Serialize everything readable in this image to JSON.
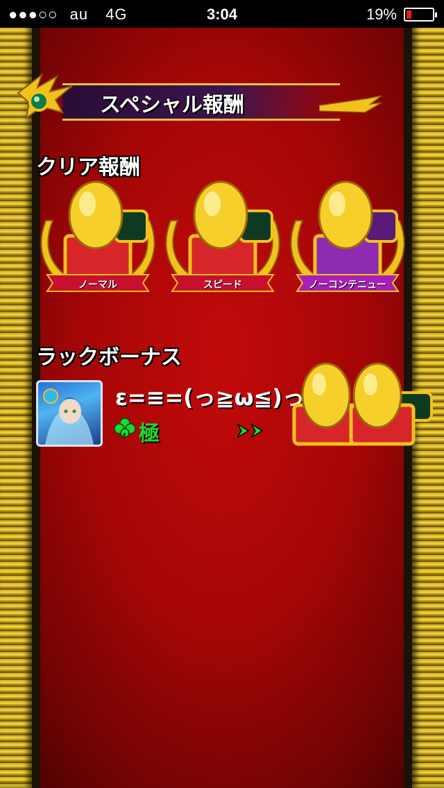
{
  "status_bar": {
    "signal": "●●●○○",
    "carrier": "au",
    "network": "4G",
    "time": "3:04",
    "battery_percent": "19%"
  },
  "header": {
    "title": "スペシャル報酬"
  },
  "clear_rewards": {
    "heading": "クリア報酬",
    "items": [
      {
        "label": "ノーマル",
        "ribbon_color": "#c8102e"
      },
      {
        "label": "スピード",
        "ribbon_color": "#c8102e"
      },
      {
        "label": "ノーコンテニュー",
        "ribbon_color": "#a81fb8"
      }
    ]
  },
  "luck_bonus": {
    "heading": "ラックボーナス",
    "emote": "ε=≡=(っ≧ω≦)っ",
    "rank": "極",
    "arrows": ">>"
  },
  "colors": {
    "background": "#b00808",
    "gold": "#f2c21c",
    "rank_green": "#1ed832"
  }
}
